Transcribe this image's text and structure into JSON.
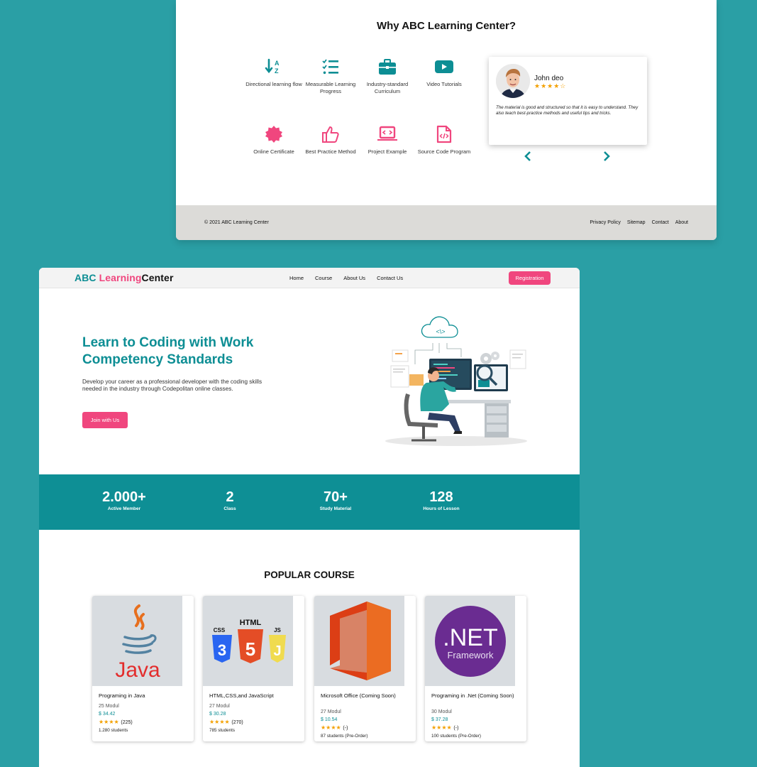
{
  "why": {
    "title": "Why ABC Learning Center?",
    "features": [
      {
        "label": "Directional learning flow",
        "icon": "sort-az-icon",
        "color": "#0d8e94"
      },
      {
        "label": "Measurable Learning Progress",
        "icon": "checklist-icon",
        "color": "#0d8e94"
      },
      {
        "label": "Industry-standard Curriculum",
        "icon": "briefcase-icon",
        "color": "#0d8e94"
      },
      {
        "label": "Video Tutorials",
        "icon": "play-video-icon",
        "color": "#0d8e94"
      },
      {
        "label": "Online Certificate",
        "icon": "certificate-icon",
        "color": "#f0467e"
      },
      {
        "label": "Best Practice Method",
        "icon": "thumbs-up-icon",
        "color": "#f0467e"
      },
      {
        "label": "Project Example",
        "icon": "laptop-code-icon",
        "color": "#f0467e"
      },
      {
        "label": "Source Code Program",
        "icon": "code-file-icon",
        "color": "#f0467e"
      }
    ],
    "review": {
      "name": "John deo",
      "stars": "★★★★☆",
      "rating": 4,
      "text": "The material is good and structured so that it is easy to understand. They also teach best-practice methods and useful tips and tricks."
    }
  },
  "footer": {
    "copyright": "© 2021 ABC Learning Center",
    "links": [
      "Privacy Policy",
      "Sitemap",
      "Contact",
      "About"
    ]
  },
  "nav": {
    "brand_1": "ABC ",
    "brand_2": "Learning",
    "brand_3": "Center",
    "items": [
      "Home",
      "Course",
      "About Us",
      "Contact Us"
    ],
    "register": "Registration"
  },
  "hero": {
    "title": "Learn to Coding with Work Competency Standards",
    "subtitle": "Develop your career as a professional developer with the coding skills needed in the industry through Codepolitan online classes.",
    "cta": "Join with Us"
  },
  "stats": [
    {
      "value": "2.000+",
      "label": "Active Member"
    },
    {
      "value": "2",
      "label": "Class"
    },
    {
      "value": "70+",
      "label": "Study Material"
    },
    {
      "value": "128",
      "label": "Hours of Lesson"
    }
  ],
  "popular": {
    "title": "POPULAR COURSE",
    "courses": [
      {
        "title": "Programing in Java",
        "modules": "25 Modul",
        "price": "$ 34.42",
        "stars": "★★★★",
        "rating_count": "(225)",
        "students": "1.280 students",
        "logo": "java-logo"
      },
      {
        "title": "HTML,CSS,and JavaScript",
        "modules": "27 Modul",
        "price": "$ 30.28",
        "stars": "★★★★",
        "rating_count": "(270)",
        "students": "785 students",
        "logo": "html-css-js-logo"
      },
      {
        "title": "Microsoft Office (Coming Soon)",
        "modules": "27 Modul",
        "price": "$ 10.54",
        "stars": "★★★★",
        "rating_count": "(-)",
        "students": "87 students (Pre-Order)",
        "logo": "office-logo"
      },
      {
        "title": "Programing in .Net (Coming Soon)",
        "modules": "30 Modul",
        "price": "$ 37.28",
        "stars": "★★★★",
        "rating_count": "(-)",
        "students": "100 students (Pre-Order)",
        "logo": "dotnet-logo"
      }
    ]
  },
  "logos": {
    "java": "Java",
    "html": "HTML",
    "css": "CSS",
    "js": "JS",
    "dotnet_1": ".NET",
    "dotnet_2": "Framework",
    "code_tag": "<\\>"
  }
}
